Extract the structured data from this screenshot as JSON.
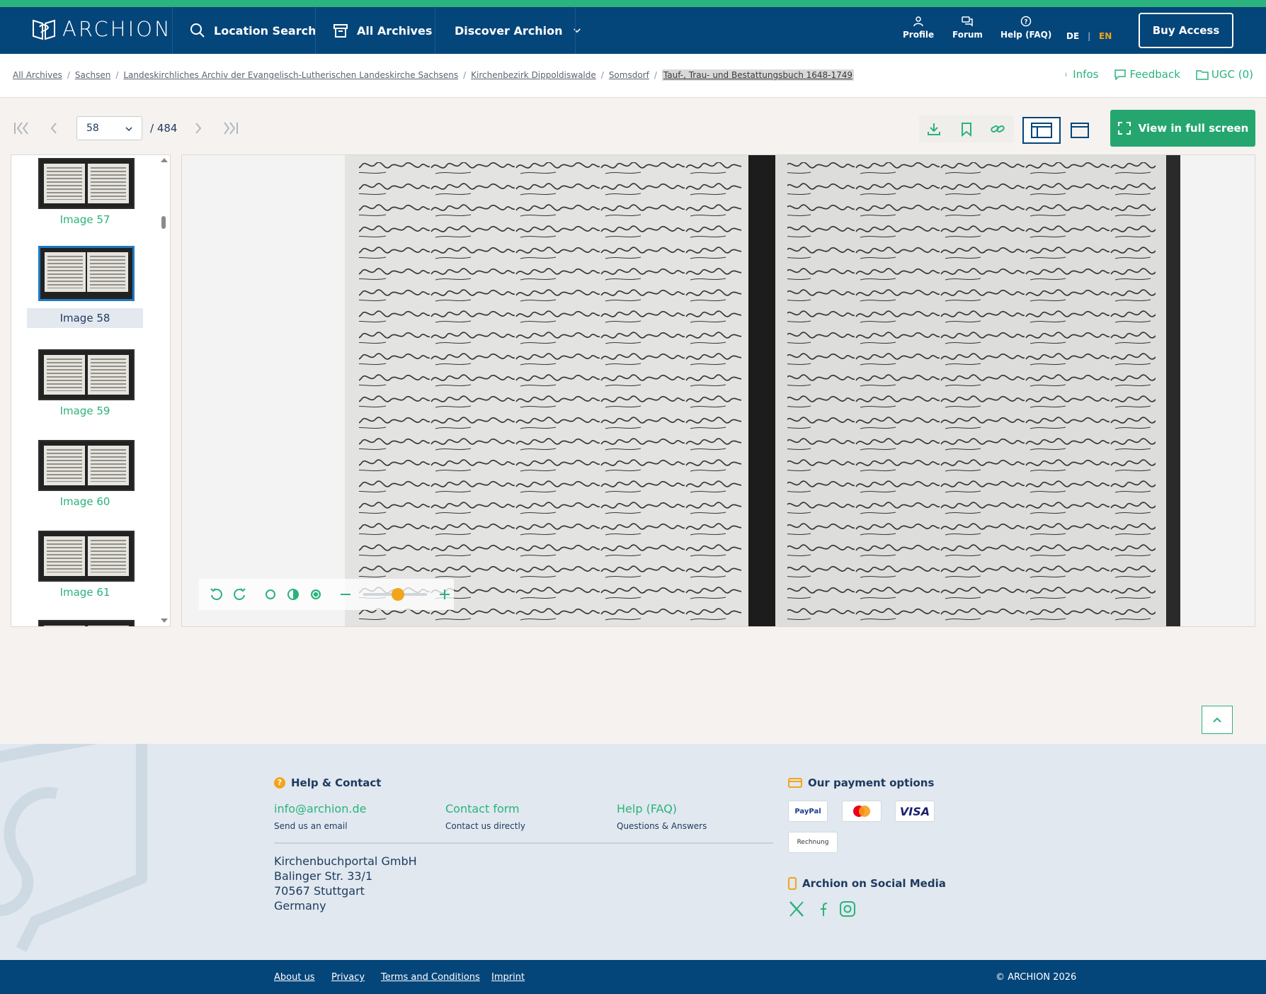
{
  "brand": {
    "name": "ARCHION"
  },
  "nav": {
    "location_search": "Location Search",
    "all_archives": "All Archives",
    "discover": "Discover Archion",
    "profile": "Profile",
    "forum": "Forum",
    "help": "Help (FAQ)",
    "lang_de": "DE",
    "lang_sep": "|",
    "lang_en": "EN",
    "buy": "Buy Access"
  },
  "breadcrumb": {
    "items": [
      "All Archives",
      "Sachsen",
      "Landeskirchliches Archiv der Evangelisch-Lutherischen Landeskirche Sachsens",
      "Kirchenbezirk Dippoldiswalde",
      "Somsdorf"
    ],
    "current": "Tauf-, Trau- und Bestattungsbuch 1648-1749",
    "sep": "/"
  },
  "actions": {
    "infos": "Infos",
    "feedback": "Feedback",
    "ugc": "UGC (0)"
  },
  "pager": {
    "current": "58",
    "total": "/ 484",
    "fullscreen": "View in full screen"
  },
  "thumbnails": [
    {
      "label": "Image 57",
      "active": false
    },
    {
      "label": "Image 58",
      "active": true
    },
    {
      "label": "Image 59",
      "active": false
    },
    {
      "label": "Image 60",
      "active": false
    },
    {
      "label": "Image 61",
      "active": false
    }
  ],
  "viewer": {
    "zoom_fraction": 0.54
  },
  "footer": {
    "help_title": "Help & Contact",
    "help_icon": "?",
    "contacts": [
      {
        "title": "info@archion.de",
        "sub": "Send us an email"
      },
      {
        "title": "Contact form",
        "sub": "Contact us directly"
      },
      {
        "title": "Help (FAQ)",
        "sub": "Questions & Answers"
      }
    ],
    "address": [
      "Kirchenbuchportal GmbH",
      "Balinger Str. 33/1",
      "70567 Stuttgart",
      "Germany"
    ],
    "payment_title": "Our payment options",
    "payments": [
      "PayPal",
      "Mastercard",
      "VISA",
      "Rechnung"
    ],
    "social_title": "Archion on Social Media",
    "social": [
      "x-icon",
      "facebook-icon",
      "instagram-icon"
    ]
  },
  "bottom": {
    "links": [
      "About us",
      "Privacy",
      "Terms and Conditions",
      "Imprint"
    ],
    "copyright": "© ARCHION 2026"
  },
  "colors": {
    "primary": "#04457a",
    "accent": "#2ab37c",
    "highlight": "#f2a51a"
  }
}
